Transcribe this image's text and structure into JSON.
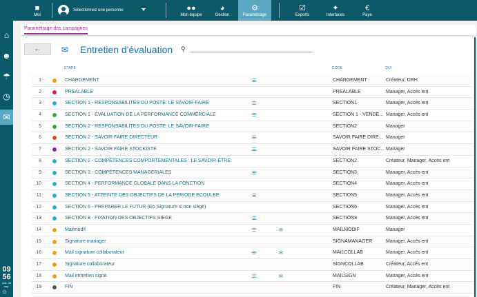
{
  "topbar": {
    "moi_label": "Moi",
    "person_label": "Sélectionnez une personne",
    "nav": [
      {
        "label": "Mon équipe",
        "icon": "team-icon"
      },
      {
        "label": "Gestion",
        "icon": "pie-chart-icon"
      },
      {
        "label": "Paramétrage",
        "icon": "gear-icon"
      },
      {
        "label": "Exports",
        "icon": "clipboard-check-icon"
      },
      {
        "label": "Interfaces",
        "icon": "puzzle-icon"
      },
      {
        "label": "Paye",
        "icon": "euro-icon"
      }
    ],
    "active": "Paramétrage",
    "colors": {
      "bar": "#0c5969",
      "active": "#5aa9c0"
    }
  },
  "sidebar": {
    "items": [
      "home-icon",
      "user-icon",
      "umbrella-icon",
      "clock-icon",
      "chat-icon"
    ],
    "active": "chat-icon",
    "time": "09",
    "time2": "56",
    "date": "mar. 20 sep."
  },
  "page": {
    "tab_label": "Paramétrage des campagnes",
    "title": "Entretien d'évaluation",
    "search_placeholder": "",
    "headers": {
      "etape": "ETAPE",
      "code": "CODE",
      "qui": "QUI"
    },
    "accent": "#1b6fb5"
  },
  "rows": [
    {
      "n": "1",
      "color": "#f39c12",
      "etape": "CHARGEMENT",
      "list": true,
      "mail": false,
      "code": "CHARGEMENT",
      "qui": "Créateur, DRH"
    },
    {
      "n": "2",
      "color": "#d81b60",
      "etape": "PREALABLE",
      "list": false,
      "mail": false,
      "code": "PREALABLE",
      "qui": "Manager, Accès ent"
    },
    {
      "n": "3",
      "color": "#1fb3d1",
      "etape": "SECTION 1 - RESPONSABILITES DU POSTE: LE SAVOIR-FAIRE",
      "list": true,
      "mail": false,
      "code": "SECTION1",
      "qui": "Manager, Accès ent"
    },
    {
      "n": "4",
      "color": "#43a047",
      "etape": "SECTION 1 - ÉVALUATION DE LA PERFORMANCE COMMERCIALE",
      "list": true,
      "mail": false,
      "code": "SECTION 1 - VENDE...",
      "qui": "Manager, Accès ent"
    },
    {
      "n": "5",
      "color": "#43a047",
      "etape": "SECTION 2 - RESPONSABILITES DU POSTE: LE SAVOIR-FAIRE",
      "list": false,
      "mail": false,
      "code": "SECTION2",
      "qui": "Manager"
    },
    {
      "n": "6",
      "color": "#e64a19",
      "etape": "SECTION 2 - SAVOIR FAIRE DIRECTEUR",
      "list": true,
      "mail": false,
      "code": "SAVOIR FAIRE DIRE...",
      "qui": "Manager"
    },
    {
      "n": "7",
      "color": "#8e24aa",
      "etape": "SECTION 2 - SAVOIR FAIRE STOCKISTE",
      "list": true,
      "mail": false,
      "code": "SAVOIR FAIRE STOC...",
      "qui": "Manager"
    },
    {
      "n": "8",
      "color": "#1fb3d1",
      "etape": "SECTION 2 - COMPÉTENCES COMPORTEMENTALES : LE SAVOIR-ÊTRE",
      "list": false,
      "mail": false,
      "code": "SECTION2",
      "qui": "Créateur, Manager, Accès ent"
    },
    {
      "n": "9",
      "color": "#1fb3d1",
      "etape": "SECTION 3 - COMPÉTENCES MANAGERIALES",
      "list": true,
      "mail": false,
      "code": "SECTION3",
      "qui": "Manager, Accès ent"
    },
    {
      "n": "10",
      "color": "#1fb3d1",
      "etape": "SECTION 4 - PERFORMANCE GLOBALE DANS LA FONCTION",
      "list": false,
      "mail": false,
      "code": "SECTION4",
      "qui": "Manager, Accès ent"
    },
    {
      "n": "11",
      "color": "#1fb3d1",
      "etape": "SECTION 5 - ATTEINTE DES OBJECTIFS DE LA PERIODE ECOULEE",
      "list": true,
      "mail": false,
      "code": "SECTION5",
      "qui": "Manager, Accès ent"
    },
    {
      "n": "12",
      "color": "#1fb3d1",
      "etape": "SECTION 6 - PREPARER LE FUTUR (Go Signature si non siège)",
      "list": false,
      "mail": false,
      "code": "SECTION6",
      "qui": "Manager, Accès ent"
    },
    {
      "n": "13",
      "color": "#1fb3d1",
      "etape": "SECTION 8 - FIXATION DES OBJECTIFS SIEGE",
      "list": true,
      "mail": false,
      "code": "SECTION8",
      "qui": "Manager, Accès ent"
    },
    {
      "n": "14",
      "color": "#f39c12",
      "etape": "Mailmodif",
      "list": true,
      "mail": true,
      "code": "MAILMODIF",
      "qui": "Manager"
    },
    {
      "n": "15",
      "color": "#f39c12",
      "etape": "Signature manager",
      "list": false,
      "mail": false,
      "code": "SIGNAMANAGER",
      "qui": "Manager, Accès ent"
    },
    {
      "n": "16",
      "color": "#f39c12",
      "etape": "Mail signature collaborateur",
      "list": true,
      "mail": true,
      "code": "MAILCOLLAB",
      "qui": "Manager, Accès ent"
    },
    {
      "n": "17",
      "color": "#f39c12",
      "etape": "Signature collaborateur",
      "list": false,
      "mail": false,
      "code": "SIGNCOLLAB",
      "qui": "Créateur, Accès ent"
    },
    {
      "n": "18",
      "color": "#f39c12",
      "etape": "Mail entretien signé",
      "list": true,
      "mail": true,
      "code": "MAILSIGN",
      "qui": "Manager, Accès ent"
    },
    {
      "n": "19",
      "color": "#555555",
      "etape": "FIN",
      "list": false,
      "mail": false,
      "code": "FIN",
      "qui": "Créateur, Manager, Accès ent"
    }
  ]
}
